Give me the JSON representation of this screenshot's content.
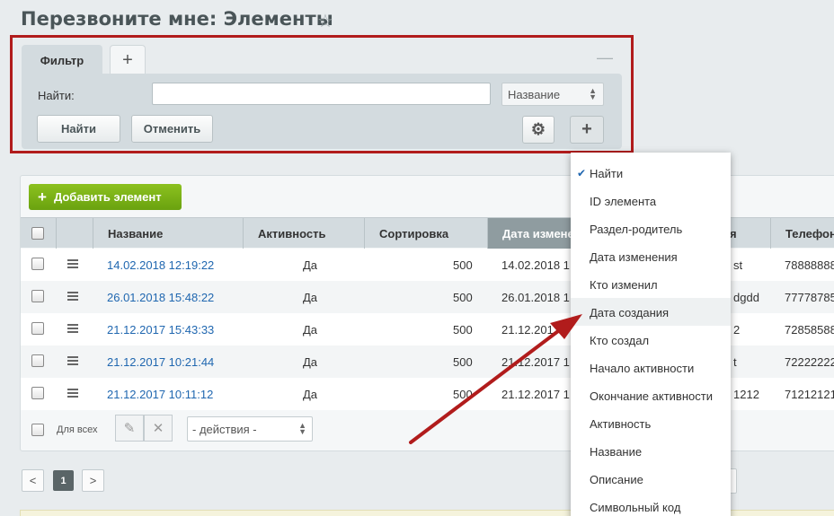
{
  "page": {
    "title": "Перезвоните мне: Элементы"
  },
  "filter": {
    "tabs": [
      {
        "label": "Фильтр"
      },
      {
        "label": "+"
      }
    ],
    "find_label": "Найти:",
    "find_value": "",
    "select_value": "Название",
    "buttons": {
      "find": "Найти",
      "cancel": "Отменить"
    }
  },
  "grid": {
    "add_button": "Добавить элемент",
    "columns": [
      "Название",
      "Активность",
      "Сортировка",
      "Дата измене",
      "ия",
      "Телефон"
    ],
    "rows": [
      {
        "name": "14.02.2018 12:19:22",
        "active": "Да",
        "sort": "500",
        "date": "14.02.2018 1",
        "extra": "st",
        "phone": "78888888"
      },
      {
        "name": "26.01.2018 15:48:22",
        "active": "Да",
        "sort": "500",
        "date": "26.01.2018 1",
        "extra": "dgdd",
        "phone": "77778785"
      },
      {
        "name": "21.12.2017 15:43:33",
        "active": "Да",
        "sort": "500",
        "date": "21.12.2017",
        "extra": "2",
        "phone": "72858588"
      },
      {
        "name": "21.12.2017 10:21:44",
        "active": "Да",
        "sort": "500",
        "date": "21.12.2017 1",
        "extra": "t",
        "phone": "72222222"
      },
      {
        "name": "21.12.2017 10:11:12",
        "active": "Да",
        "sort": "500",
        "date": "21.12.2017 1",
        "extra": "1212",
        "phone": "71212121"
      }
    ],
    "footer": {
      "for_all": "Для всех",
      "actions": "- действия -"
    },
    "pager": {
      "prev": "<",
      "current": "1",
      "next": ">"
    }
  },
  "dropdown": {
    "items": [
      {
        "label": "Найти",
        "checked": true
      },
      {
        "label": "ID элемента"
      },
      {
        "label": "Раздел-родитель"
      },
      {
        "label": "Дата изменения"
      },
      {
        "label": "Кто изменил"
      },
      {
        "label": "Дата создания",
        "highlighted": true
      },
      {
        "label": "Кто создал"
      },
      {
        "label": "Начало активности"
      },
      {
        "label": "Окончание активности"
      },
      {
        "label": "Активность"
      },
      {
        "label": "Название"
      },
      {
        "label": "Описание"
      },
      {
        "label": "Символьный код"
      }
    ]
  },
  "colors": {
    "annotation_red": "#b11c1c",
    "link_blue": "#2067b0",
    "add_green": "#7ab318"
  }
}
